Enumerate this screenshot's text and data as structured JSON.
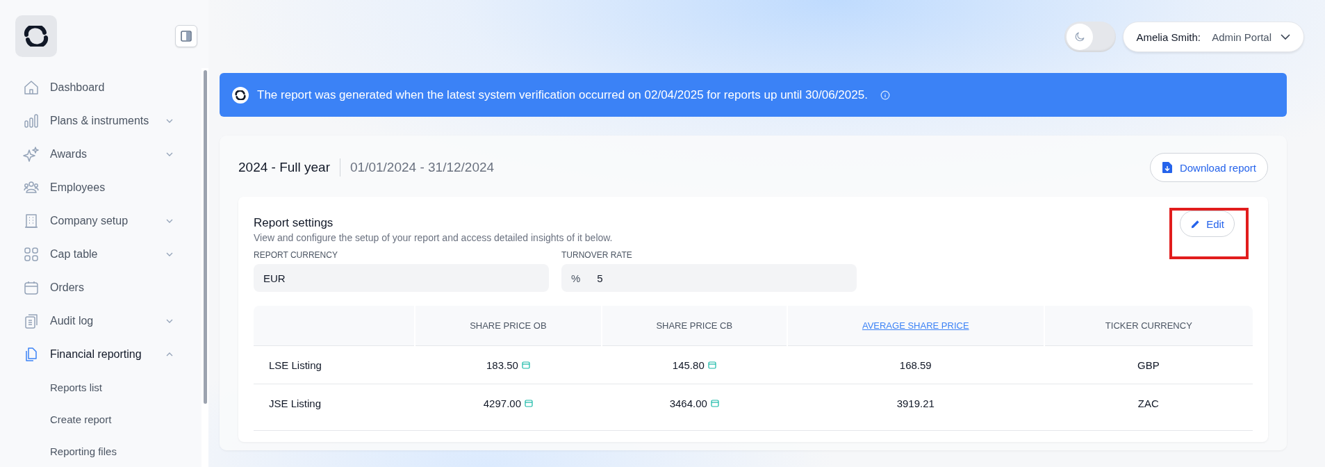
{
  "sidebar": {
    "items": [
      {
        "label": "Dashboard",
        "expandable": false,
        "expanded": false,
        "selected": false
      },
      {
        "label": "Plans & instruments",
        "expandable": true,
        "expanded": false,
        "selected": false
      },
      {
        "label": "Awards",
        "expandable": true,
        "expanded": false,
        "selected": false
      },
      {
        "label": "Employees",
        "expandable": false,
        "expanded": false,
        "selected": false
      },
      {
        "label": "Company setup",
        "expandable": true,
        "expanded": false,
        "selected": false
      },
      {
        "label": "Cap table",
        "expandable": true,
        "expanded": false,
        "selected": false
      },
      {
        "label": "Orders",
        "expandable": false,
        "expanded": false,
        "selected": false
      },
      {
        "label": "Audit log",
        "expandable": true,
        "expanded": false,
        "selected": false
      },
      {
        "label": "Financial reporting",
        "expandable": true,
        "expanded": true,
        "selected": true,
        "children": [
          {
            "label": "Reports list",
            "selected": false
          },
          {
            "label": "Create report",
            "selected": false
          },
          {
            "label": "Reporting files",
            "selected": false
          }
        ]
      }
    ]
  },
  "topbar": {
    "dark_mode": {
      "on": false
    },
    "user": {
      "name": "Amelia Smith:",
      "portal": "Admin Portal"
    }
  },
  "banner": {
    "text": "The report was generated when the latest system verification occurred on 02/04/2025 for reports up until 30/06/2025."
  },
  "report": {
    "title": "2024 - Full year",
    "period": "01/01/2024 - 31/12/2024",
    "download_button": "Download report",
    "settings": {
      "title": "Report settings",
      "description": "View and configure the setup of your report and access detailed insights of it below.",
      "edit_button": {
        "label": "Edit",
        "highlighted": true
      },
      "fields": [
        {
          "label": "REPORT CURRENCY",
          "value": "EUR"
        },
        {
          "label": "TURNOVER RATE",
          "prefix": "%",
          "value": "5"
        }
      ]
    },
    "table": {
      "columns": [
        {},
        {
          "label": "SHARE PRICE OB",
          "link": false
        },
        {
          "label": "SHARE PRICE CB",
          "link": false
        },
        {
          "label": "AVERAGE SHARE PRICE",
          "link": true
        },
        {
          "label": "TICKER CURRENCY",
          "link": false
        }
      ],
      "rows": [
        {
          "cells": [
            {
              "value": "LSE Listing",
              "calendar": false
            },
            {
              "value": "183.50",
              "calendar": true
            },
            {
              "value": "145.80",
              "calendar": true
            },
            {
              "value": "168.59",
              "calendar": false
            },
            {
              "value": "GBP",
              "calendar": false
            }
          ]
        },
        {
          "cells": [
            {
              "value": "JSE Listing",
              "calendar": false
            },
            {
              "value": "4297.00",
              "calendar": true
            },
            {
              "value": "3464.00",
              "calendar": true
            },
            {
              "value": "3919.21",
              "calendar": false
            },
            {
              "value": "ZAC",
              "calendar": false
            }
          ]
        }
      ]
    }
  }
}
